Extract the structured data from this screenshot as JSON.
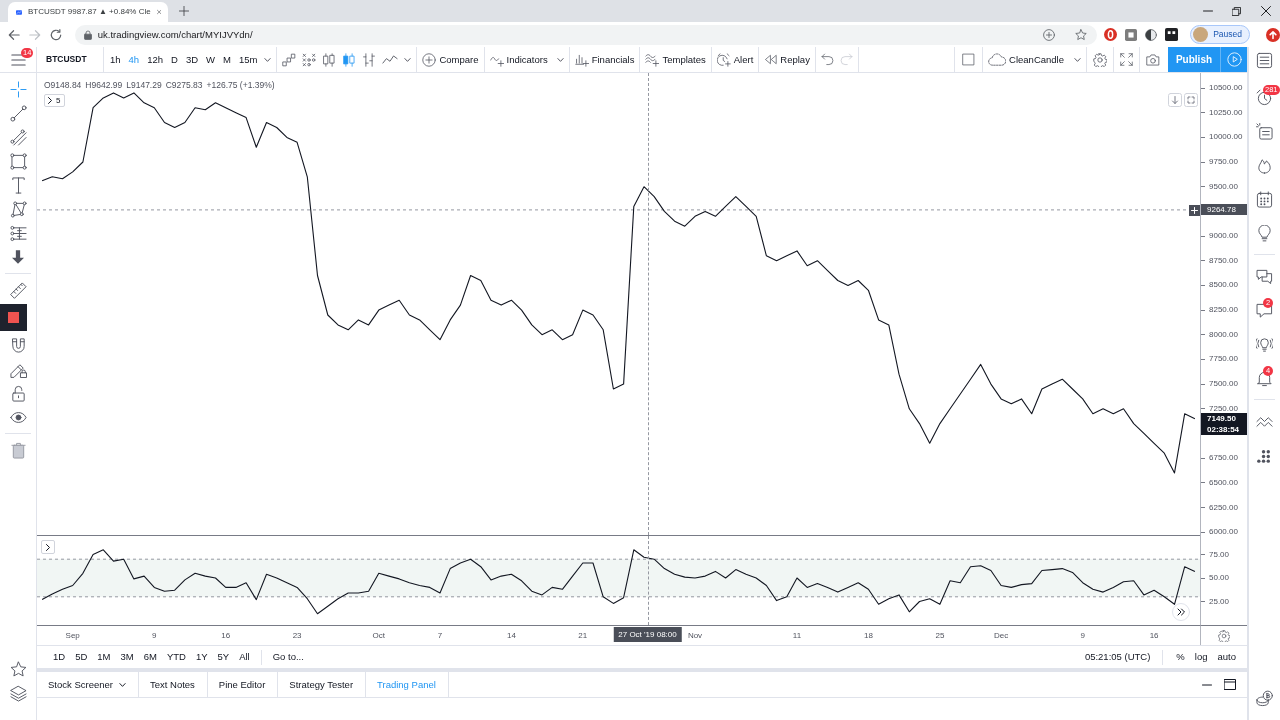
{
  "browser": {
    "tab": {
      "title": "BTCUSDT 9987.87 ▲ +0.84% Cle"
    },
    "url": "uk.tradingview.com/chart/MYIJVYdn/",
    "profile": {
      "label": "Paused"
    }
  },
  "menu": {
    "badge": "14"
  },
  "toolbar": {
    "symbol": "BTCUSDT",
    "intervals": [
      {
        "label": "1h",
        "selected": false
      },
      {
        "label": "4h",
        "selected": true
      },
      {
        "label": "12h",
        "selected": false
      },
      {
        "label": "D",
        "selected": false
      },
      {
        "label": "3D",
        "selected": false
      },
      {
        "label": "W",
        "selected": false
      },
      {
        "label": "M",
        "selected": false
      },
      {
        "label": "15m",
        "selected": false
      }
    ],
    "chart_styles": [
      {
        "kind": "linebreak",
        "selected": false
      },
      {
        "kind": "pointfigure",
        "selected": false
      },
      {
        "kind": "hollow",
        "selected": false
      },
      {
        "kind": "candles",
        "selected": true
      },
      {
        "kind": "bars",
        "selected": false
      },
      {
        "kind": "line",
        "selected": false
      }
    ],
    "actions": [
      {
        "kind": "compare",
        "label": "Compare",
        "dropdown": false
      },
      {
        "kind": "indicators",
        "label": "Indicators",
        "dropdown": true
      },
      {
        "kind": "financials",
        "label": "Financials",
        "dropdown": false
      },
      {
        "kind": "templates",
        "label": "Templates",
        "dropdown": false
      },
      {
        "kind": "alert",
        "label": "Alert",
        "dropdown": false
      },
      {
        "kind": "replay",
        "label": "Replay",
        "dropdown": false
      }
    ],
    "undo": {
      "disabled": false
    },
    "redo": {
      "disabled": true
    },
    "layout": {
      "label": "CleanCandle"
    },
    "publish": {
      "label": "Publish"
    }
  },
  "left_toolbar": {
    "groups": [
      {
        "tools": [
          {
            "kind": "crosshair",
            "selected": true
          },
          {
            "kind": "trendline",
            "selected": false
          },
          {
            "kind": "fib",
            "selected": false
          },
          {
            "kind": "rectangle",
            "selected": false
          },
          {
            "kind": "text",
            "selected": false
          },
          {
            "kind": "pattern",
            "selected": false
          },
          {
            "kind": "prediction",
            "selected": false
          },
          {
            "kind": "collapse",
            "selected": false
          }
        ]
      },
      {
        "tools": [
          {
            "kind": "ruler",
            "selected": false
          },
          {
            "kind": "stop",
            "selected": false
          },
          {
            "kind": "magnet",
            "selected": false
          },
          {
            "kind": "drawlock",
            "selected": false
          },
          {
            "kind": "lock",
            "selected": false
          },
          {
            "kind": "eye",
            "selected": false
          }
        ]
      },
      {
        "tools": [
          {
            "kind": "trash",
            "selected": false
          }
        ]
      }
    ],
    "bottom": [
      {
        "kind": "star"
      },
      {
        "kind": "layers"
      }
    ]
  },
  "chart": {
    "legend": [
      "O9148.84",
      "H9642.99",
      "L9147.29",
      "C9275.83",
      "+126.75 (+1.39%)"
    ],
    "hidden_indicators": "5",
    "chart_data": {
      "type": "line",
      "series": [
        {
          "color": "#131722",
          "values": [
            9560,
            9600,
            9580,
            9650,
            9750,
            10300,
            10400,
            10450,
            10400,
            10450,
            10350,
            10300,
            10150,
            10100,
            10150,
            10300,
            10280,
            10350,
            10300,
            10250,
            10200,
            9900,
            10150,
            10100,
            10000,
            9950,
            9600,
            8600,
            8200,
            8100,
            8050,
            8150,
            8100,
            8250,
            8300,
            8350,
            8200,
            8150,
            8050,
            7950,
            8150,
            8300,
            8600,
            8550,
            8350,
            8300,
            8350,
            8250,
            8100,
            8000,
            8050,
            7950,
            8000,
            8250,
            8200,
            8050,
            7450,
            7500,
            9300,
            9500,
            9400,
            9250,
            9150,
            9100,
            9200,
            9250,
            9200,
            9300,
            9400,
            9300,
            9200,
            8800,
            8750,
            8800,
            8850,
            8700,
            8750,
            8650,
            8550,
            8500,
            8550,
            8450,
            8150,
            8100,
            7600,
            7250,
            7100,
            6900,
            7100,
            7250,
            7400,
            7550,
            7700,
            7500,
            7350,
            7300,
            7350,
            7200,
            7450,
            7500,
            7550,
            7450,
            7350,
            7200,
            7250,
            7200,
            7250,
            7100,
            7000,
            6900,
            6800,
            6600,
            7200,
            7149.5
          ]
        }
      ],
      "categories": [
        null,
        null,
        null,
        null,
        null,
        null,
        null,
        null,
        null,
        null,
        null,
        null,
        null,
        null,
        null,
        null,
        null,
        null,
        null,
        null,
        null,
        null,
        null,
        null,
        null,
        null,
        null,
        null,
        null,
        null,
        null,
        null,
        null,
        null,
        null,
        null,
        null,
        null,
        null,
        null,
        null,
        null,
        null,
        null,
        null,
        null,
        null,
        null,
        null,
        null,
        null,
        null,
        null,
        null,
        null,
        null,
        null,
        null,
        null,
        null,
        null,
        null,
        null,
        null,
        null,
        null,
        null,
        null,
        null,
        null,
        null,
        null,
        null,
        null,
        null,
        null,
        null,
        null,
        null,
        null,
        null,
        null,
        null,
        null,
        null,
        null,
        null,
        null,
        null,
        null,
        null,
        null,
        null,
        null,
        null,
        null,
        null,
        null,
        null,
        null,
        null,
        null,
        null,
        null,
        null,
        null,
        null,
        null,
        null,
        null,
        null,
        null,
        null,
        null
      ],
      "ylim": [
        5971,
        10652
      ],
      "yticks": [
        {
          "value": 10500,
          "label": "10500.00"
        },
        {
          "value": 10250,
          "label": "10250.00"
        },
        {
          "value": 10000,
          "label": "10000.00"
        },
        {
          "value": 9750,
          "label": "9750.00"
        },
        {
          "value": 9500,
          "label": "9500.00"
        },
        {
          "value": 9000,
          "label": "9000.00"
        },
        {
          "value": 8750,
          "label": "8750.00"
        },
        {
          "value": 8500,
          "label": "8500.00"
        },
        {
          "value": 8250,
          "label": "8250.00"
        },
        {
          "value": 8000,
          "label": "8000.00"
        },
        {
          "value": 7750,
          "label": "7750.00"
        },
        {
          "value": 7500,
          "label": "7500.00"
        },
        {
          "value": 7250,
          "label": "7250.00"
        },
        {
          "value": 6750,
          "label": "6750.00"
        },
        {
          "value": 6500,
          "label": "6500.00"
        },
        {
          "value": 6250,
          "label": "6250.00"
        },
        {
          "value": 6000,
          "label": "6000.00"
        }
      ],
      "ref_lines": [
        {
          "axis": "y",
          "value": 9264.78
        }
      ],
      "annotations": [
        "7149.50"
      ]
    },
    "price_axis": {
      "crosshair_label": "9264.78",
      "countdown": "02:38:54"
    }
  },
  "rsi": {
    "chart_data": {
      "type": "line",
      "series": [
        {
          "color": "#131722",
          "values": [
            27,
            33,
            38,
            42,
            55,
            75,
            80,
            68,
            70,
            49,
            52,
            40,
            36,
            37,
            48,
            55,
            52,
            50,
            40,
            40,
            45,
            27,
            54,
            50,
            45,
            40,
            28,
            12,
            20,
            28,
            34,
            34,
            36,
            55,
            52,
            49,
            45,
            42,
            40,
            34,
            60,
            66,
            70,
            62,
            48,
            52,
            54,
            47,
            36,
            32,
            40,
            38,
            52,
            66,
            66,
            30,
            23,
            29,
            80,
            72,
            70,
            60,
            54,
            51,
            50,
            52,
            57,
            50,
            59,
            54,
            50,
            42,
            26,
            30,
            50,
            40,
            44,
            40,
            35,
            40,
            45,
            38,
            22,
            28,
            32,
            14,
            25,
            28,
            22,
            47,
            45,
            62,
            63,
            58,
            42,
            40,
            43,
            44,
            58,
            59,
            60,
            56,
            45,
            38,
            35,
            40,
            46,
            47,
            32,
            37,
            30,
            22,
            62,
            57
          ]
        }
      ],
      "categories": [
        null,
        null,
        null,
        "Sep",
        null,
        null,
        null,
        null,
        null,
        null,
        null,
        "9",
        null,
        null,
        null,
        null,
        null,
        null,
        "16",
        null,
        null,
        null,
        null,
        null,
        null,
        "23",
        null,
        null,
        null,
        null,
        null,
        null,
        null,
        "Oct",
        null,
        null,
        null,
        null,
        null,
        "7",
        null,
        null,
        null,
        null,
        null,
        null,
        "14",
        null,
        null,
        null,
        null,
        null,
        null,
        "21",
        null,
        null,
        null,
        null,
        null,
        null,
        null,
        null,
        null,
        null,
        "Nov",
        null,
        null,
        null,
        null,
        null,
        null,
        null,
        null,
        null,
        "11",
        null,
        null,
        null,
        null,
        null,
        null,
        "18",
        null,
        null,
        null,
        null,
        null,
        null,
        "25",
        null,
        null,
        null,
        null,
        null,
        "Dec",
        null,
        null,
        null,
        null,
        null,
        null,
        null,
        "9",
        null,
        null,
        null,
        null,
        null,
        null,
        "16",
        null,
        null,
        null,
        null
      ],
      "ylim": [
        0,
        94.7
      ],
      "yticks": [
        {
          "value": 75,
          "label": "75.00"
        },
        {
          "value": 50,
          "label": "50.00"
        },
        {
          "value": 25,
          "label": "25.00"
        }
      ],
      "bands": [
        {
          "axis": "y",
          "from": 30,
          "to": 70
        }
      ]
    }
  },
  "time_axis": {
    "crosshair_label": "27 Oct '19 08:00"
  },
  "range_bar": {
    "ranges": [
      "1D",
      "5D",
      "1M",
      "3M",
      "6M",
      "YTD",
      "1Y",
      "5Y",
      "All"
    ],
    "goto": "Go to...",
    "clock": "05:21:05 (UTC)",
    "scale_modes": [
      {
        "label": "%",
        "selected": false
      },
      {
        "label": "log",
        "selected": false
      },
      {
        "label": "auto",
        "selected": false
      }
    ]
  },
  "bottom_panel": {
    "tabs": [
      {
        "label": "Stock Screener",
        "selected": false,
        "dropdown": true
      },
      {
        "label": "Text Notes",
        "selected": false,
        "dropdown": false
      },
      {
        "label": "Pine Editor",
        "selected": false,
        "dropdown": false
      },
      {
        "label": "Strategy Tester",
        "selected": false,
        "dropdown": false
      },
      {
        "label": "Trading Panel",
        "selected": true,
        "dropdown": false
      }
    ]
  },
  "right_sidebar": {
    "groups": [
      {
        "items": [
          {
            "kind": "watchlist"
          },
          {
            "kind": "alerts",
            "badge": "281"
          },
          {
            "kind": "news"
          },
          {
            "kind": "hotlist"
          },
          {
            "kind": "calendar"
          },
          {
            "kind": "ideas"
          }
        ]
      },
      {
        "items": [
          {
            "kind": "chats"
          },
          {
            "kind": "messages",
            "badge": "2"
          },
          {
            "kind": "streams"
          },
          {
            "kind": "notifications",
            "badge": "4"
          }
        ]
      },
      {
        "items": [
          {
            "kind": "datawindow"
          },
          {
            "kind": "hotkeys"
          }
        ]
      }
    ],
    "bottom": [
      {
        "kind": "trading"
      }
    ]
  }
}
